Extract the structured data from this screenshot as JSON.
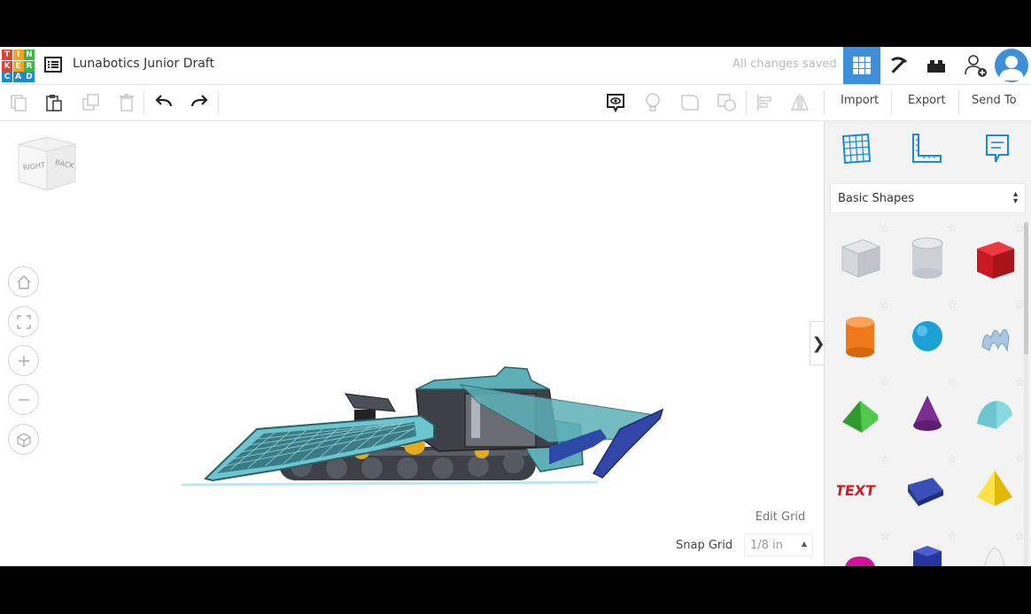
{
  "app": {
    "logo_letters": [
      "T",
      "I",
      "N",
      "K",
      "E",
      "R",
      "C",
      "A",
      "D"
    ],
    "logo_colors": [
      "#e2402f",
      "#f7a21b",
      "#39b54a",
      "#e2402f",
      "#f7a21b",
      "#39b54a",
      "#1a8ad4",
      "#1a8ad4",
      "#1a8ad4"
    ],
    "title": "Lunabotics Junior Draft",
    "save_status": "All changes saved",
    "accent_color": "#3d8fd9"
  },
  "toolbar": {
    "import_label": "Import",
    "export_label": "Export",
    "send_to_label": "Send To"
  },
  "viewcube": {
    "right_label": "RIGHT",
    "back_label": "BACK"
  },
  "workplane": {
    "edit_grid_label": "Edit Grid",
    "snap_grid_label": "Snap Grid",
    "snap_grid_value": "1/8 in"
  },
  "shapes_panel": {
    "category": "Basic Shapes",
    "text_shape_label": "TEXT",
    "shapes": [
      {
        "icon": "box-hole-icon",
        "color": "#c8ccd2"
      },
      {
        "icon": "cylinder-hole-icon",
        "color": "#c8ccd2"
      },
      {
        "icon": "box-icon",
        "color": "#d41a24"
      },
      {
        "icon": "cylinder-icon",
        "color": "#ef7a1c"
      },
      {
        "icon": "sphere-icon",
        "color": "#1ba1d6"
      },
      {
        "icon": "scribble-icon",
        "color": "#a9c7e0"
      },
      {
        "icon": "roof-icon",
        "color": "#3fae3d"
      },
      {
        "icon": "cone-icon",
        "color": "#7c2d94"
      },
      {
        "icon": "round-roof-icon",
        "color": "#6cc5cf"
      },
      {
        "icon": "text-icon",
        "color": "#d41a24"
      },
      {
        "icon": "wedge-icon",
        "color": "#26369a"
      },
      {
        "icon": "pyramid-icon",
        "color": "#f3d000"
      },
      {
        "icon": "half-sphere-icon",
        "color": "#d0119a"
      },
      {
        "icon": "polygon-icon",
        "color": "#26369a"
      },
      {
        "icon": "paraboloid-icon",
        "color": "#e6e6e6"
      }
    ]
  }
}
